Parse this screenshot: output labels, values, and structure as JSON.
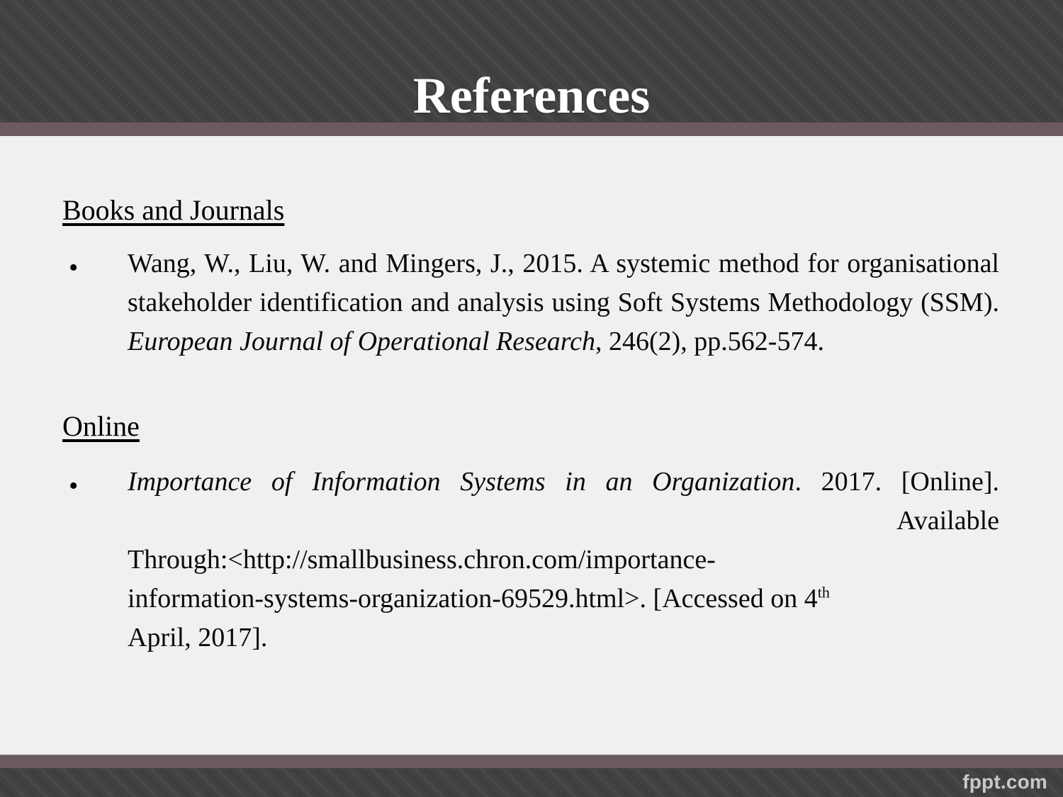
{
  "slide": {
    "title": "References",
    "background_color": "#f0f0f0",
    "band_color": "#414141",
    "accent_rule_color": "#6b5a5e",
    "title_color": "#ffffff"
  },
  "sections": [
    {
      "heading": "Books and Journals",
      "entries": [
        {
          "bullet": "•",
          "parts": {
            "lead": "Wang, W., Liu, W. and Mingers, J., 2015. A systemic method for organisational stakeholder identification and analysis using Soft Systems Methodology (SSM). ",
            "italic_title": "European Journal of Operational Research",
            "tail": ",  246(2), pp.562-574."
          }
        }
      ]
    },
    {
      "heading": "Online",
      "entries": [
        {
          "bullet": "•",
          "parts": {
            "italic_title": "Importance of Information Systems in an Organization",
            "after_title": ". 2017. [Online].",
            "available_word": "Available",
            "through_label": "Through:<http://smallbusiness.chron.com/importance-",
            "url_tail": "information-systems-organization-69529.html>. [Accessed on 4",
            "ordinal_suffix": "th",
            "accessed_date": "April, 2017]."
          }
        }
      ]
    }
  ],
  "footer": {
    "watermark": "fppt.com"
  }
}
